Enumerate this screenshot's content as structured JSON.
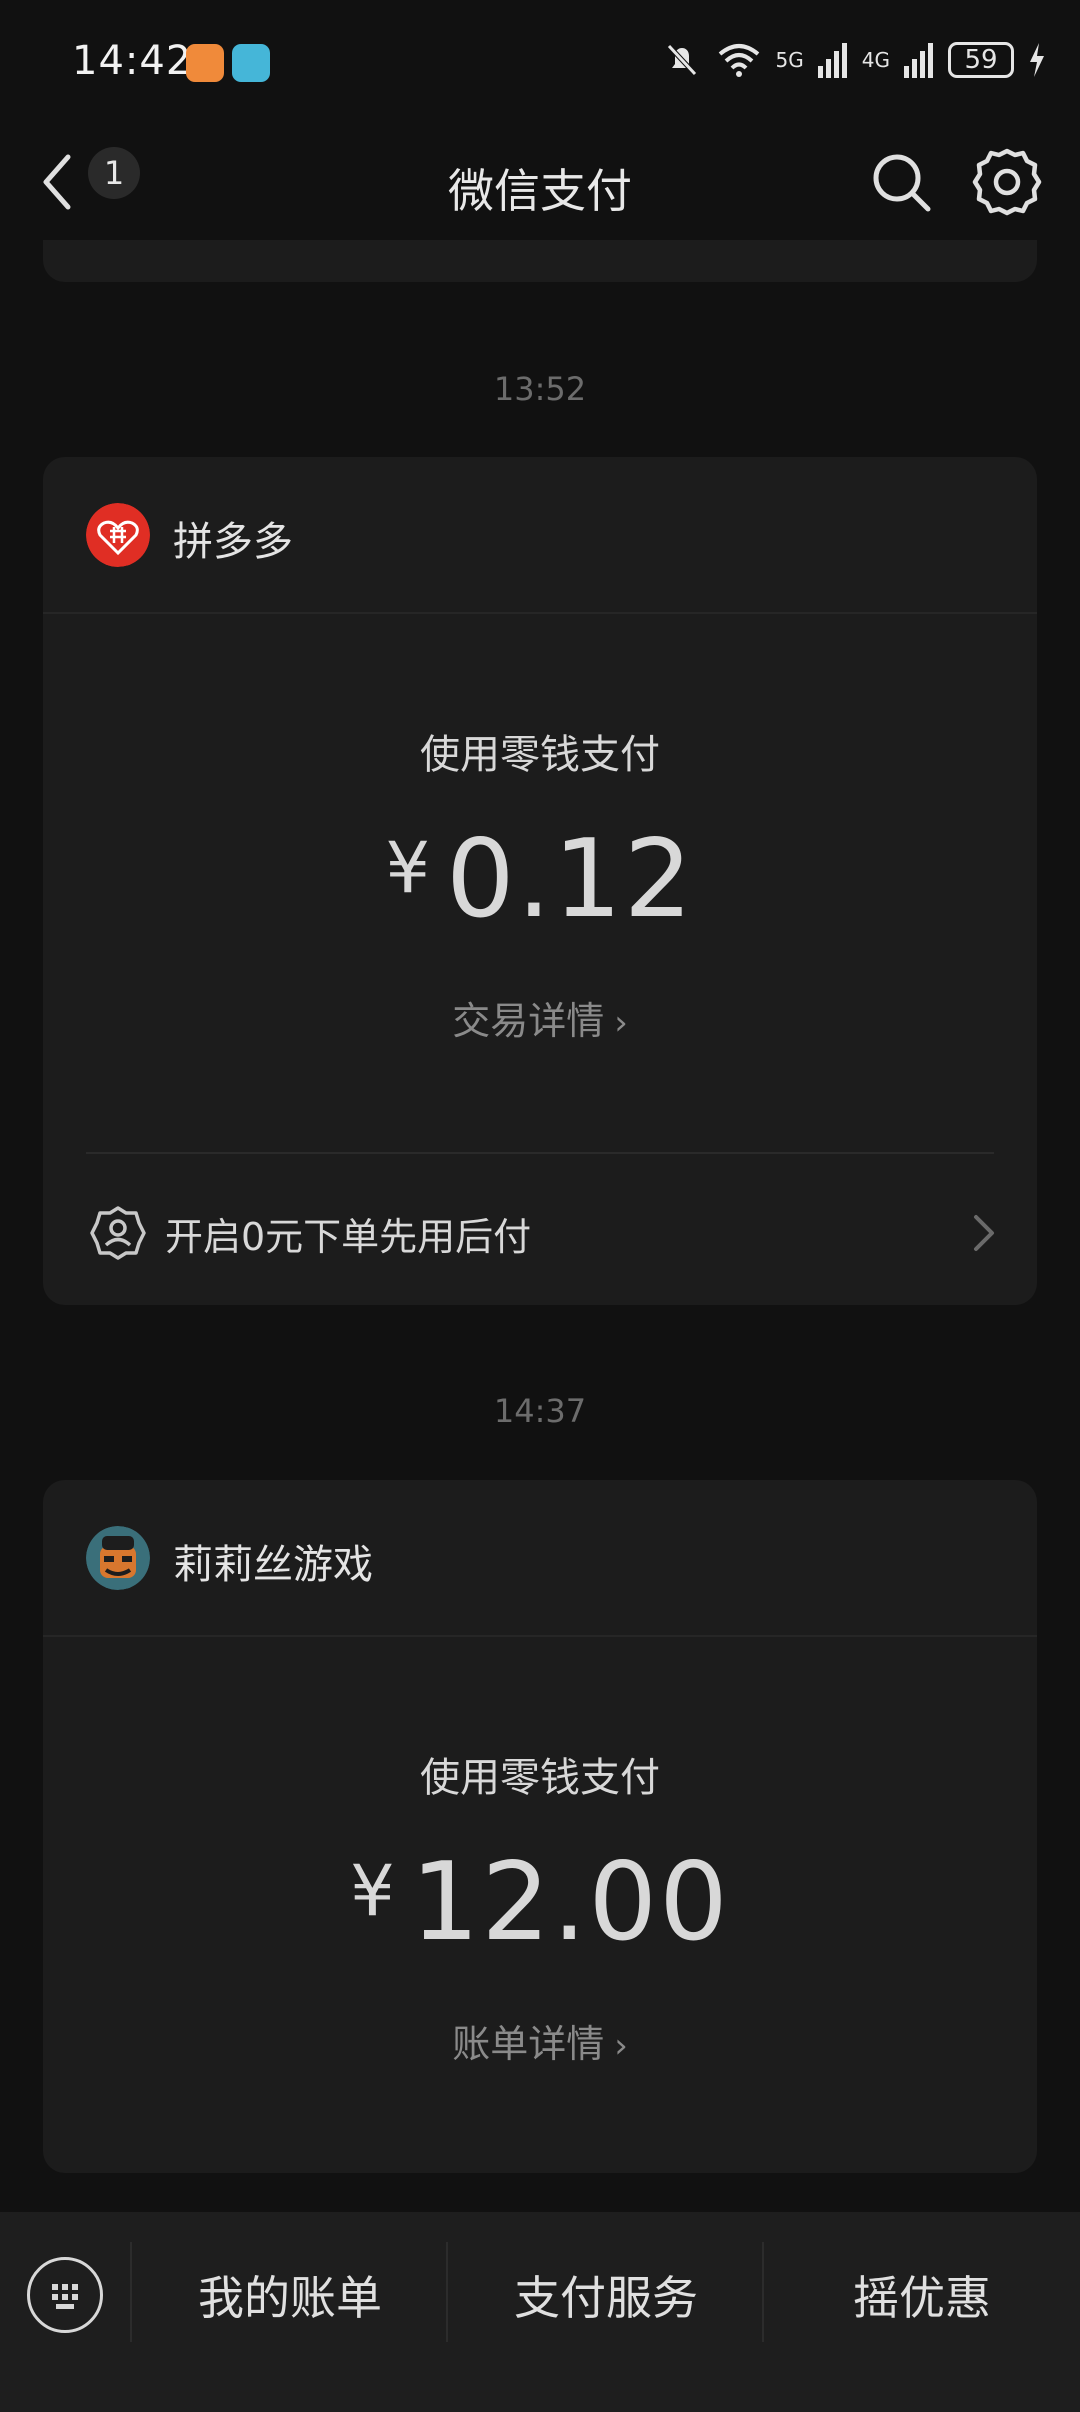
{
  "status_bar": {
    "time": "14:42",
    "network_5g": "5G",
    "network_4g": "4G",
    "battery": "59",
    "icons": [
      "heart-app-icon",
      "book-app-icon",
      "mute-bell-icon",
      "wifi-icon",
      "signal-icon",
      "battery-icon",
      "charging-icon"
    ]
  },
  "nav": {
    "title": "微信支付",
    "unread_count": "1"
  },
  "messages": [
    {
      "time": "13:52",
      "merchant": "拼多多",
      "pay_method": "使用零钱支付",
      "currency": "¥",
      "amount": "0.12",
      "detail_link": "交易详情",
      "promo": "开启0元下单先用后付"
    },
    {
      "time": "14:37",
      "merchant": "莉莉丝游戏",
      "pay_method": "使用零钱支付",
      "currency": "¥",
      "amount": "12.00",
      "detail_link": "账单详情"
    }
  ],
  "bottom_menu": {
    "items": [
      "我的账单",
      "支付服务",
      "摇优惠"
    ]
  },
  "colors": {
    "background": "#111111",
    "card": "#1c1c1c",
    "bottom_bar": "#1e1e1e",
    "pdd_red": "#e02e24"
  }
}
